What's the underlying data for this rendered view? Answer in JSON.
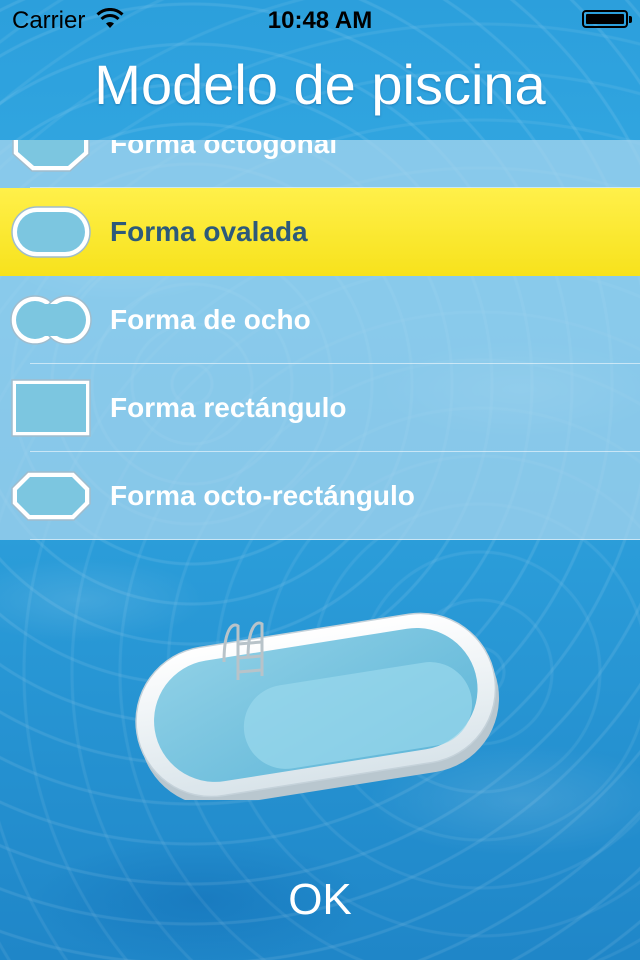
{
  "status_bar": {
    "carrier": "Carrier",
    "time": "10:48 AM"
  },
  "title": "Modelo de piscina",
  "shapes": [
    {
      "label": "Forma octogonal",
      "icon": "octagon-pool-icon",
      "selected": false
    },
    {
      "label": "Forma ovalada",
      "icon": "oval-pool-icon",
      "selected": true
    },
    {
      "label": "Forma de ocho",
      "icon": "figure-eight-pool-icon",
      "selected": false
    },
    {
      "label": "Forma rectángulo",
      "icon": "rectangle-pool-icon",
      "selected": false
    },
    {
      "label": "Forma octo-rectángulo",
      "icon": "octo-rectangle-pool-icon",
      "selected": false
    }
  ],
  "ok_label": "OK",
  "colors": {
    "selected_row": "#f7e21c",
    "selected_text": "#2d5a7a",
    "row_text": "#ffffff",
    "water": "#2c9fdc"
  }
}
